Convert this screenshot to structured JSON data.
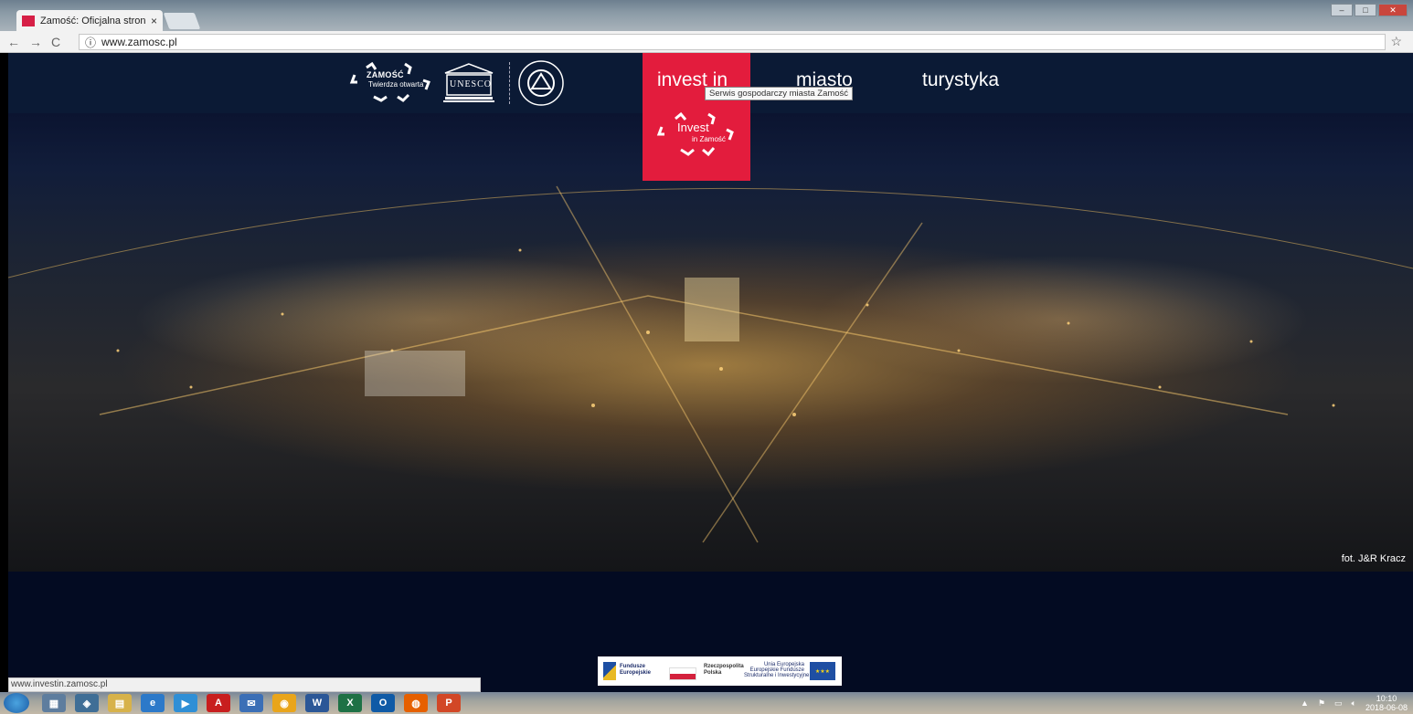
{
  "browser": {
    "tab_title": "Zamość: Oficjalna strona",
    "tab_close": "×",
    "url": "www.zamosc.pl",
    "info_icon": "ⓘ",
    "back": "←",
    "forward": "→",
    "reload": "C",
    "bookmark_star": "☆",
    "status_url": "www.investin.zamosc.pl"
  },
  "header": {
    "zamosc_logo": {
      "line1": "ZAMOŚĆ",
      "line2": "Twierdza otwarta"
    },
    "unesco_logo": "UNESCO",
    "nav": [
      {
        "label": "invest in"
      },
      {
        "label": "miasto"
      },
      {
        "label": "turystyka"
      }
    ],
    "tooltip": "Serwis gospodarczy miasta Zamość",
    "invest_logo": {
      "line1": "Invest",
      "line2": "in Zamość"
    }
  },
  "hero": {
    "credit": "fot. J&R Kracz"
  },
  "footer_logos": {
    "fe": "Fundusze\nEuropejskie",
    "pl": "Rzeczpospolita\nPolska",
    "ue": "Unia Europejska\nEuropejskie Fundusze\nStrukturalne i Inwestycyjne"
  },
  "taskbar": {
    "time": "10:10",
    "date": "2018-06-08"
  },
  "colors": {
    "accent_red": "#e31c3d",
    "header_bg": "#0b1a35",
    "page_bg": "#030b22"
  }
}
